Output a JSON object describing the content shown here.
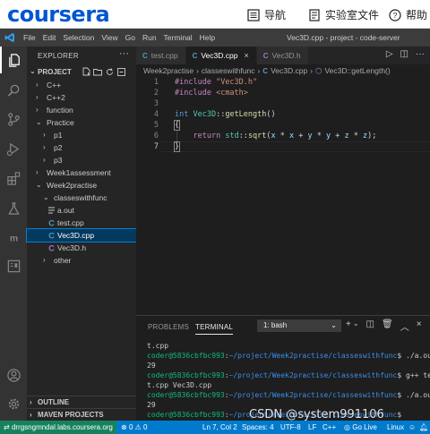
{
  "coursera": {
    "logo": "coursera",
    "nav": [
      {
        "icon": "compass-icon",
        "label": "导航"
      },
      {
        "icon": "lab-notebook-icon",
        "label": "实验室文件"
      },
      {
        "icon": "help-icon",
        "label": "帮助"
      }
    ]
  },
  "menubar": {
    "items": [
      "File",
      "Edit",
      "Selection",
      "View",
      "Go",
      "Run",
      "Terminal",
      "Help"
    ],
    "window_title": "Vec3D.cpp - project - code-server"
  },
  "sidebar": {
    "header": "EXPLORER",
    "project": "PROJECT",
    "tree": [
      {
        "label": "C++",
        "arrow": "›",
        "depth": 1,
        "kind": "folder"
      },
      {
        "label": "C++2",
        "arrow": "›",
        "depth": 1,
        "kind": "folder"
      },
      {
        "label": "function",
        "arrow": "›",
        "depth": 1,
        "kind": "folder"
      },
      {
        "label": "Practice",
        "arrow": "⌄",
        "depth": 1,
        "kind": "folder"
      },
      {
        "label": "p1",
        "arrow": "›",
        "depth": 2,
        "kind": "folder"
      },
      {
        "label": "p2",
        "arrow": "›",
        "depth": 2,
        "kind": "folder"
      },
      {
        "label": "p3",
        "arrow": "›",
        "depth": 2,
        "kind": "folder"
      },
      {
        "label": "Week1assessment",
        "arrow": "›",
        "depth": 1,
        "kind": "folder"
      },
      {
        "label": "Week2practise",
        "arrow": "⌄",
        "depth": 1,
        "kind": "folder"
      },
      {
        "label": "classeswithfunc",
        "arrow": "⌄",
        "depth": 2,
        "kind": "folder"
      },
      {
        "label": "a.out",
        "arrow": "",
        "depth": 3,
        "kind": "binary"
      },
      {
        "label": "test.cpp",
        "arrow": "",
        "depth": 3,
        "kind": "cpp"
      },
      {
        "label": "Vec3D.cpp",
        "arrow": "",
        "depth": 3,
        "kind": "cpp",
        "selected": true
      },
      {
        "label": "Vec3D.h",
        "arrow": "",
        "depth": 3,
        "kind": "h"
      },
      {
        "label": "other",
        "arrow": "›",
        "depth": 2,
        "kind": "folder"
      }
    ],
    "outline": "OUTLINE",
    "maven": "MAVEN PROJECTS"
  },
  "editor": {
    "tabs": [
      {
        "label": "test.cpp",
        "icon": "C",
        "active": false
      },
      {
        "label": "Vec3D.cpp",
        "icon": "C",
        "active": true,
        "close": "×"
      },
      {
        "label": "Vec3D.h",
        "icon": "C",
        "active": false
      }
    ],
    "breadcrumbs": [
      "Week2practise",
      "classeswithfunc",
      "Vec3D.cpp",
      "Vec3D::getLength()"
    ],
    "code_lines": [
      {
        "n": "1",
        "html": "<span class=\"pp\">#include</span> <span class=\"str\">\"Vec3D.h\"</span>"
      },
      {
        "n": "2",
        "html": "<span class=\"pp\">#include</span> <span class=\"str\">&lt;cmath&gt;</span>"
      },
      {
        "n": "3",
        "html": ""
      },
      {
        "n": "4",
        "html": "<span class=\"ty\">int</span> <span class=\"cls\">Vec3D</span>::<span class=\"fn\">getLength</span>()"
      },
      {
        "n": "5",
        "html": "<span class=\"brace\">{</span>"
      },
      {
        "n": "6",
        "html": "    <span class=\"kw\">return</span> <span class=\"cls\">std</span>::<span class=\"fn\">sqrt</span>(<span class=\"vr\">x</span> * <span class=\"vr\">x</span> + <span class=\"vr\">y</span> * <span class=\"vr\">y</span> + <span class=\"vr\">z</span> * <span class=\"vr\">z</span>);"
      },
      {
        "n": "7",
        "html": "<span class=\"brace\">}</span>"
      }
    ]
  },
  "panel": {
    "tabs": [
      "PROBLEMS",
      "TERMINAL"
    ],
    "terminal_select": "1: bash",
    "lines": [
      {
        "type": "out",
        "text": "t.cpp"
      },
      {
        "type": "prompt",
        "user": "coder@5836cbfbc993",
        "path": "~/project/Week2practise/classeswithfunc",
        "cmd": "$ ./a.out"
      },
      {
        "type": "out",
        "text": "29"
      },
      {
        "type": "prompt",
        "user": "coder@5836cbfbc993",
        "path": "~/project/Week2practise/classeswithfunc",
        "cmd": "$ g++ tes"
      },
      {
        "type": "out",
        "text": "t.cpp Vec3D.cpp"
      },
      {
        "type": "prompt",
        "user": "coder@5836cbfbc993",
        "path": "~/project/Week2practise/classeswithfunc",
        "cmd": "$ ./a.out"
      },
      {
        "type": "out",
        "text": "29"
      },
      {
        "type": "prompt",
        "user": "coder@5836cbfbc993",
        "path": "~/project/Week2practise/classeswithfunc",
        "cmd": "$ "
      }
    ]
  },
  "statusbar": {
    "remote": "drrgsngmndal.labs.coursera.org",
    "errors": "0",
    "warnings": "0",
    "position": "Ln 7, Col 2",
    "spaces": "Spaces: 4",
    "encoding": "UTF-8",
    "eol": "LF",
    "language": "C++",
    "golive": "Go Live",
    "os": "Linux"
  },
  "watermark": "CSDN @system991106",
  "colors": {
    "coursera_blue": "#0056d2",
    "statusbar": "#007acc",
    "remote": "#16825d",
    "selection": "#04395e"
  }
}
